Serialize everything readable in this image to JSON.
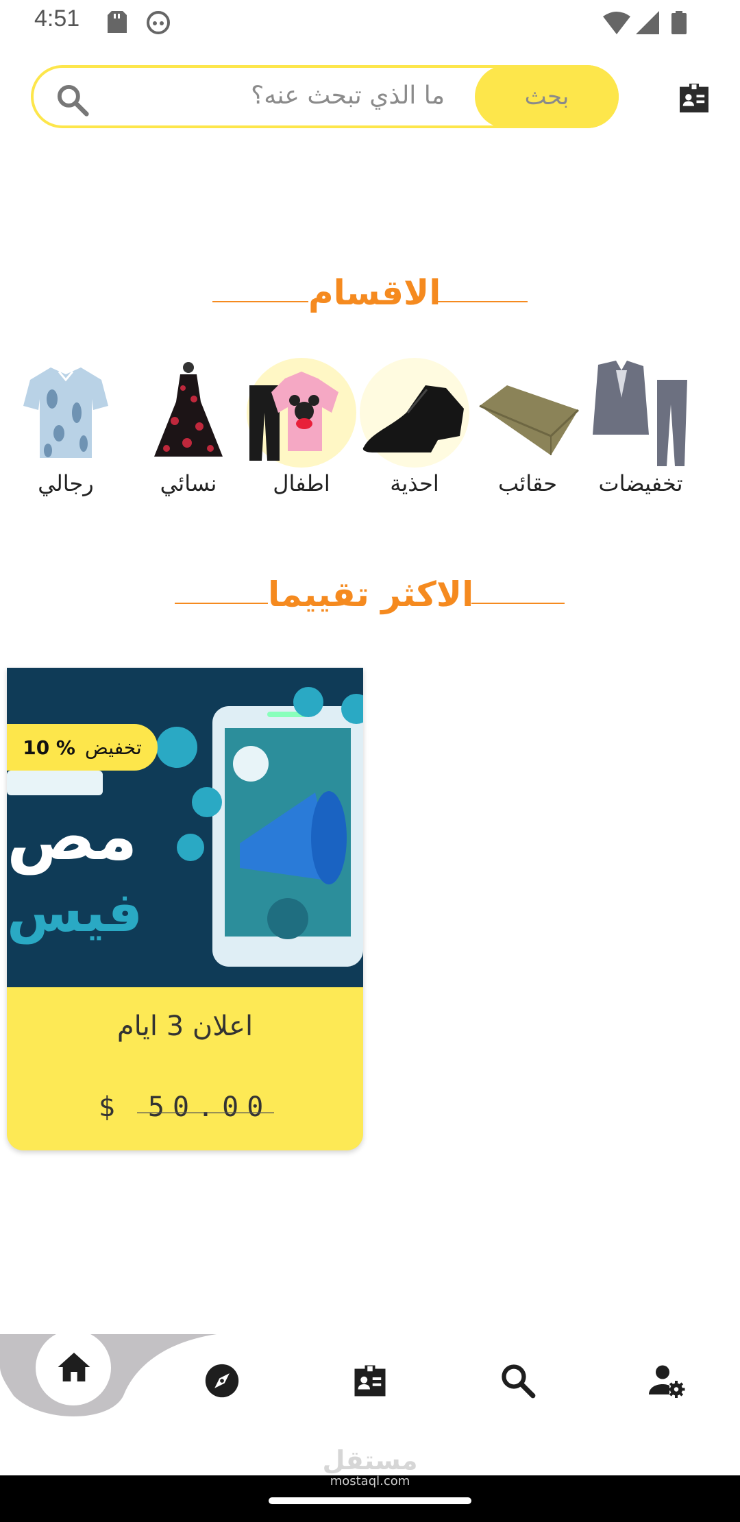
{
  "status_bar": {
    "time": "4:51"
  },
  "search": {
    "placeholder": "ما الذي تبحث عنه؟",
    "button_label": "بحث"
  },
  "categories_section": {
    "title": "الاقسام",
    "items": [
      {
        "label": "رجالي",
        "icon": "shirt-icon"
      },
      {
        "label": "نسائي",
        "icon": "dress-icon"
      },
      {
        "label": "اطفال",
        "icon": "kids-outfit-icon"
      },
      {
        "label": "احذية",
        "icon": "shoe-icon"
      },
      {
        "label": "حقائب",
        "icon": "wallet-icon"
      },
      {
        "label": "تخفيضات",
        "icon": "suit-icon"
      }
    ]
  },
  "top_rated_section": {
    "title": "الاكثر تقييما"
  },
  "product": {
    "discount_word": "تخفيض",
    "discount_value": "10 %",
    "title": "اعلان 3 ايام",
    "price": "$ 50.00",
    "image_text_1": "مص",
    "image_text_2": "فيس"
  },
  "bottom_nav": [
    "home-icon",
    "explore-icon",
    "badge-icon",
    "search-icon",
    "user-settings-icon"
  ],
  "watermark": {
    "text": "مستقل",
    "sub": "mostaql.com"
  },
  "colors": {
    "accent": "#fde64b",
    "title": "#f58a1f",
    "card": "#fde955"
  }
}
